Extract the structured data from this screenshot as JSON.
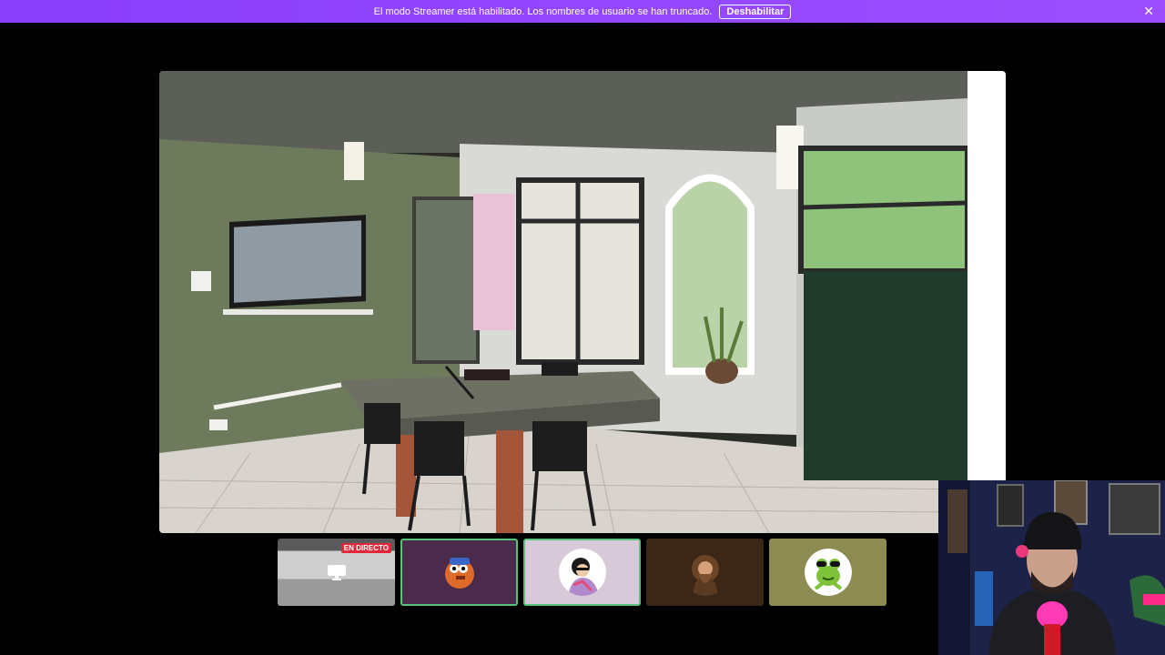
{
  "banner": {
    "message": "El modo Streamer está habilitado. Los nombres de usuario se han truncado.",
    "button_label": "Deshabilitar",
    "close_glyph": "✕",
    "background": "#9146ff"
  },
  "stage": {
    "content": "shared room video"
  },
  "participants": {
    "live_badge": "EN DIRECTO",
    "tiles": [
      {
        "type": "screenshare",
        "icon": "screen-share-icon",
        "background": "#8a8a8a"
      },
      {
        "type": "avatar",
        "background": "#4a2b4c",
        "selected": true
      },
      {
        "type": "avatar",
        "background": "#d8c9d8",
        "selected": true
      },
      {
        "type": "avatar",
        "background": "#3b2717",
        "selected": false
      },
      {
        "type": "avatar",
        "background": "#8b8b52",
        "selected": false
      }
    ]
  },
  "webcam": {
    "label": "streamer webcam"
  }
}
